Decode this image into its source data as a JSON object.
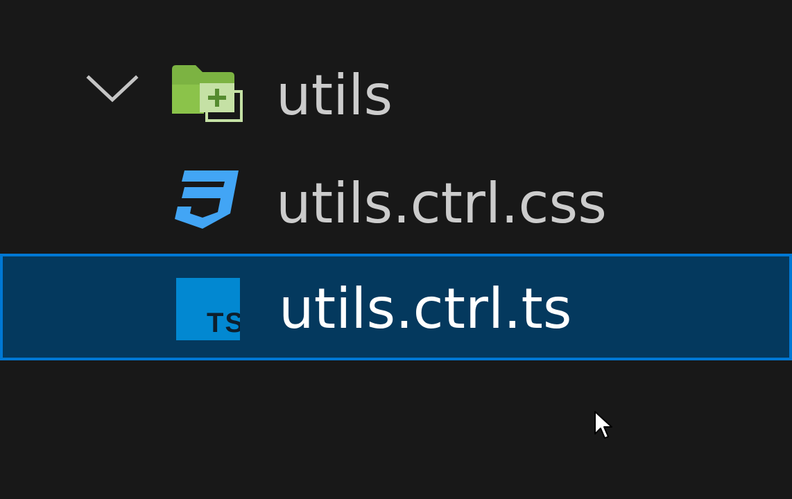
{
  "explorer": {
    "folder": {
      "name": "utils",
      "icon": "folder-add-icon",
      "expanded": true
    },
    "files": [
      {
        "name": "utils.ctrl.css",
        "icon": "css-file-icon",
        "selected": false
      },
      {
        "name": "utils.ctrl.ts",
        "icon": "typescript-file-icon",
        "icon_text": "TS",
        "selected": true
      }
    ]
  },
  "colors": {
    "background": "#181818",
    "selection_background": "#04395e",
    "selection_border": "#0078d4",
    "text": "#cccccc",
    "selected_text": "#ffffff",
    "folder_green": "#7cb342",
    "css_blue": "#42a5f5",
    "ts_blue": "#0288d1"
  }
}
